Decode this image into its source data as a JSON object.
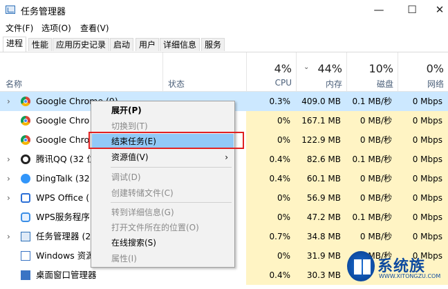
{
  "window": {
    "title": "任务管理器",
    "min": "—",
    "max": "☐",
    "close": "✕"
  },
  "menu": [
    "文件(F)",
    "选项(O)",
    "查看(V)"
  ],
  "tabs": [
    "进程",
    "性能",
    "应用历史记录",
    "启动",
    "用户",
    "详细信息",
    "服务"
  ],
  "header": {
    "name": "名称",
    "status": "状态",
    "cpu": {
      "pct": "4%",
      "label": "CPU"
    },
    "mem": {
      "pct": "44%",
      "label": "内存"
    },
    "disk": {
      "pct": "10%",
      "label": "磁盘"
    },
    "net": {
      "pct": "0%",
      "label": "网络"
    }
  },
  "rows": [
    {
      "name": "Google Chrome (9)",
      "cpu": "0.3%",
      "mem": "409.0 MB",
      "disk": "0.1 MB/秒",
      "net": "0 Mbps",
      "icon": "chrome-icon",
      "expand": "›"
    },
    {
      "name": "Google Chro",
      "cpu": "0%",
      "mem": "167.1 MB",
      "disk": "0 MB/秒",
      "net": "0 Mbps",
      "icon": "chrome-icon",
      "expand": ""
    },
    {
      "name": "Google Chro",
      "cpu": "0%",
      "mem": "122.9 MB",
      "disk": "0 MB/秒",
      "net": "0 Mbps",
      "icon": "chrome-icon",
      "expand": ""
    },
    {
      "name": "腾讯QQ (32 位)",
      "cpu": "0.4%",
      "mem": "82.6 MB",
      "disk": "0.1 MB/秒",
      "net": "0 Mbps",
      "icon": "qq-icon",
      "expand": "›"
    },
    {
      "name": "DingTalk (32",
      "cpu": "0.4%",
      "mem": "60.1 MB",
      "disk": "0 MB/秒",
      "net": "0 Mbps",
      "icon": "dingtalk-icon",
      "expand": "›"
    },
    {
      "name": "WPS Office (",
      "cpu": "0%",
      "mem": "56.9 MB",
      "disk": "0 MB/秒",
      "net": "0 Mbps",
      "icon": "wps-icon",
      "expand": "›"
    },
    {
      "name": "WPS服务程序",
      "cpu": "0%",
      "mem": "47.2 MB",
      "disk": "0.1 MB/秒",
      "net": "0 Mbps",
      "icon": "wps-cloud-icon",
      "expand": ""
    },
    {
      "name": "任务管理器 (2",
      "cpu": "0.7%",
      "mem": "34.8 MB",
      "disk": "0 MB/秒",
      "net": "0 Mbps",
      "icon": "task-manager-icon",
      "expand": "›"
    },
    {
      "name": "Windows 资源",
      "cpu": "0%",
      "mem": "31.9 MB",
      "disk": "0 MB/秒",
      "net": "0 Mbps",
      "icon": "windows-explorer-icon",
      "expand": ""
    },
    {
      "name": "桌面窗口管理器",
      "cpu": "0.4%",
      "mem": "30.3 MB",
      "disk": "",
      "net": "",
      "icon": "desktop-window-manager-icon",
      "expand": ""
    }
  ],
  "context_menu": {
    "items": [
      {
        "label": "展开(P)",
        "state": "bold"
      },
      {
        "label": "切换到(T)",
        "state": "disabled"
      },
      {
        "label": "结束任务(E)",
        "state": "highlighted"
      },
      {
        "label": "资源值(V)",
        "state": "normal",
        "submenu": "›"
      },
      {
        "label": "调试(D)",
        "state": "disabled"
      },
      {
        "label": "创建转储文件(C)",
        "state": "disabled"
      },
      {
        "label": "转到详细信息(G)",
        "state": "disabled"
      },
      {
        "label": "打开文件所在的位置(O)",
        "state": "disabled"
      },
      {
        "label": "在线搜索(S)",
        "state": "normal"
      },
      {
        "label": "属性(I)",
        "state": "disabled"
      }
    ]
  },
  "watermark": {
    "brand": "系统族",
    "url": "WWW.XITONGZU.COM"
  },
  "colors": {
    "selected_row": "#cce8ff",
    "cpu_mem_heat": "#fff4c4",
    "menu_highlight": "#91c9f7",
    "red_box": "#e02020"
  }
}
